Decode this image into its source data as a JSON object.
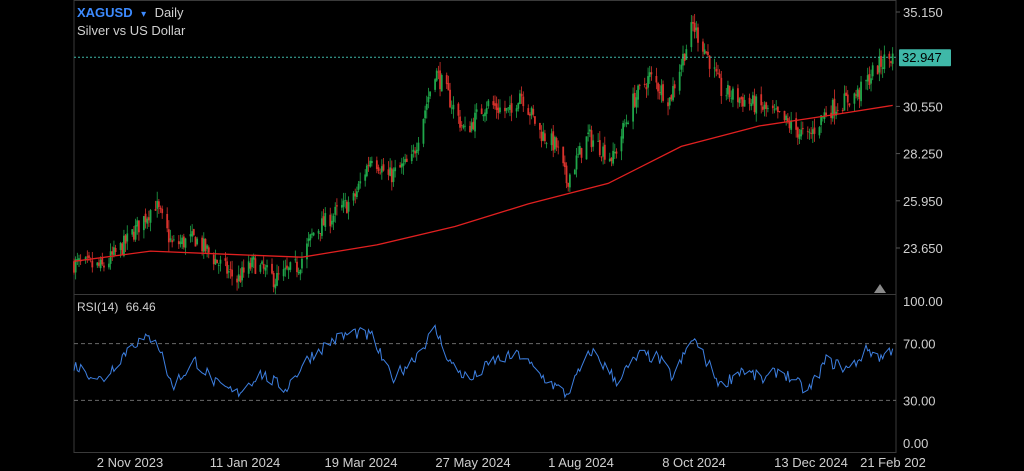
{
  "header": {
    "symbol": "XAGUSD",
    "symbol_arrow": "▾",
    "interval": "Daily",
    "description": "Silver vs US Dollar"
  },
  "rsi_header": {
    "label": "RSI(14)",
    "value": "66.46"
  },
  "last_price": "32.947",
  "colors": {
    "background": "#000000",
    "up": "#1fa64a",
    "down": "#d9322c",
    "ma": "#e02020",
    "rsi": "#3d7fe0",
    "badge": "#3fb8a8",
    "accent": "#3d8bff"
  },
  "chart_data": [
    {
      "type": "candlestick",
      "title": "XAGUSD Daily",
      "subtitle": "Silver vs US Dollar",
      "x_labels": [
        "2 Nov 2023",
        "11 Jan 2024",
        "19 Mar 2024",
        "27 May 2024",
        "1 Aug 2024",
        "8 Oct 2024",
        "13 Dec 2024",
        "21 Feb 202"
      ],
      "x_range": [
        "2023-10-16",
        "2025-02-21"
      ],
      "y_ticks": [
        "35.150",
        "30.550",
        "28.250",
        "25.950",
        "23.650"
      ],
      "ylim": [
        21.5,
        35.6
      ],
      "last_price": 32.947,
      "price_path": [
        [
          "2023-10-16",
          22.9
        ],
        [
          "2023-11-02",
          22.7
        ],
        [
          "2023-11-15",
          23.8
        ],
        [
          "2023-11-30",
          25.4
        ],
        [
          "2023-12-04",
          25.8
        ],
        [
          "2023-12-14",
          23.8
        ],
        [
          "2023-12-28",
          24.1
        ],
        [
          "2024-01-11",
          22.9
        ],
        [
          "2024-01-22",
          22.1
        ],
        [
          "2024-02-01",
          22.9
        ],
        [
          "2024-02-14",
          22.1
        ],
        [
          "2024-02-28",
          22.8
        ],
        [
          "2024-03-08",
          24.4
        ],
        [
          "2024-03-19",
          25.2
        ],
        [
          "2024-04-01",
          26.0
        ],
        [
          "2024-04-12",
          28.2
        ],
        [
          "2024-04-22",
          27.1
        ],
        [
          "2024-05-06",
          27.9
        ],
        [
          "2024-05-20",
          32.3
        ],
        [
          "2024-05-27",
          31.2
        ],
        [
          "2024-06-07",
          29.3
        ],
        [
          "2024-06-20",
          30.7
        ],
        [
          "2024-07-05",
          30.2
        ],
        [
          "2024-07-10",
          31.3
        ],
        [
          "2024-07-22",
          29.3
        ],
        [
          "2024-08-01",
          28.6
        ],
        [
          "2024-08-07",
          26.9
        ],
        [
          "2024-08-20",
          29.1
        ],
        [
          "2024-09-04",
          28.0
        ],
        [
          "2024-09-16",
          30.8
        ],
        [
          "2024-09-26",
          32.0
        ],
        [
          "2024-10-08",
          30.9
        ],
        [
          "2024-10-22",
          34.5
        ],
        [
          "2024-10-30",
          33.2
        ],
        [
          "2024-11-08",
          31.3
        ],
        [
          "2024-11-20",
          30.9
        ],
        [
          "2024-12-02",
          30.5
        ],
        [
          "2024-12-13",
          30.0
        ],
        [
          "2024-12-30",
          29.0
        ],
        [
          "2025-01-10",
          30.3
        ],
        [
          "2025-01-30",
          31.2
        ],
        [
          "2025-02-07",
          32.2
        ],
        [
          "2025-02-14",
          32.8
        ],
        [
          "2025-02-19",
          32.95
        ]
      ],
      "moving_average": {
        "x": [
          "2023-10-16",
          "2023-12-01",
          "2024-01-15",
          "2024-03-01",
          "2024-04-15",
          "2024-06-01",
          "2024-07-15",
          "2024-09-01",
          "2024-10-15",
          "2024-12-01",
          "2025-01-15",
          "2025-02-19"
        ],
        "values": [
          23.0,
          23.5,
          23.35,
          23.2,
          23.8,
          24.7,
          25.8,
          26.8,
          28.6,
          29.6,
          30.15,
          30.6
        ]
      }
    },
    {
      "type": "line",
      "title": "RSI(14)",
      "y_ticks": [
        "100.00",
        "70.00",
        "30.00",
        "0.00"
      ],
      "ylim": [
        0,
        100
      ],
      "reference_lines": [
        70,
        30
      ],
      "last_value": 66.46,
      "rsi_path": [
        [
          "2023-10-16",
          55
        ],
        [
          "2023-11-02",
          44
        ],
        [
          "2023-11-20",
          70
        ],
        [
          "2023-12-04",
          75
        ],
        [
          "2023-12-14",
          40
        ],
        [
          "2023-12-28",
          58
        ],
        [
          "2024-01-11",
          40
        ],
        [
          "2024-01-22",
          35
        ],
        [
          "2024-02-05",
          49
        ],
        [
          "2024-02-20",
          38
        ],
        [
          "2024-03-05",
          60
        ],
        [
          "2024-03-19",
          72
        ],
        [
          "2024-04-01",
          78
        ],
        [
          "2024-04-12",
          75
        ],
        [
          "2024-04-24",
          45
        ],
        [
          "2024-05-06",
          58
        ],
        [
          "2024-05-20",
          80
        ],
        [
          "2024-05-30",
          55
        ],
        [
          "2024-06-10",
          44
        ],
        [
          "2024-06-24",
          58
        ],
        [
          "2024-07-10",
          62
        ],
        [
          "2024-07-22",
          48
        ],
        [
          "2024-08-07",
          34
        ],
        [
          "2024-08-22",
          65
        ],
        [
          "2024-09-06",
          44
        ],
        [
          "2024-09-20",
          62
        ],
        [
          "2024-10-01",
          60
        ],
        [
          "2024-10-10",
          46
        ],
        [
          "2024-10-22",
          74
        ],
        [
          "2024-11-08",
          40
        ],
        [
          "2024-11-20",
          52
        ],
        [
          "2024-12-04",
          44
        ],
        [
          "2024-12-13",
          52
        ],
        [
          "2024-12-30",
          36
        ],
        [
          "2025-01-10",
          58
        ],
        [
          "2025-01-24",
          52
        ],
        [
          "2025-02-04",
          66
        ],
        [
          "2025-02-12",
          60
        ],
        [
          "2025-02-19",
          66.46
        ]
      ]
    }
  ]
}
